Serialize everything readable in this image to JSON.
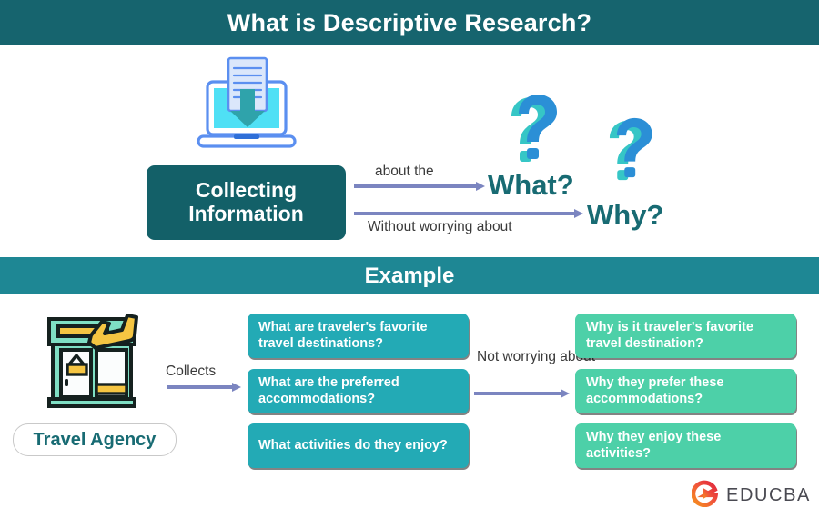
{
  "header": {
    "title": "What is Descriptive Research?"
  },
  "top_section": {
    "icon": "laptop-download-icon",
    "main_box": {
      "line1": "Collecting",
      "line2": "Information"
    },
    "arrow1_label": "about the",
    "arrow2_label": "Without worrying about",
    "question_word_1": "What?",
    "question_word_2": "Why?",
    "question_mark_icon": "question-mark-icon"
  },
  "example_section": {
    "banner": "Example",
    "agency_icon": "travel-agency-storefront-icon",
    "agency_label": "Travel Agency",
    "collects_label": "Collects",
    "not_worrying_label": "Not worrying about",
    "what_boxes": [
      "What are traveler's favorite travel destinations?",
      "What are the preferred accommodations?",
      "What activities do they enjoy?"
    ],
    "why_boxes": [
      "Why is it traveler's favorite travel destination?",
      "Why they prefer these accommodations?",
      "Why they enjoy these activities?"
    ]
  },
  "branding": {
    "logo_icon": "educba-logo-icon",
    "name": "EDUCBA"
  },
  "colors": {
    "header_teal": "#16646e",
    "banner_teal": "#1e8794",
    "box_dark_teal": "#136068",
    "box_mid_teal": "#23aab5",
    "box_mint": "#4dd0a8",
    "arrow_purple": "#7b85c0",
    "text_teal": "#186b73",
    "logo_orange": "#f05a28",
    "logo_red": "#e0263d"
  }
}
